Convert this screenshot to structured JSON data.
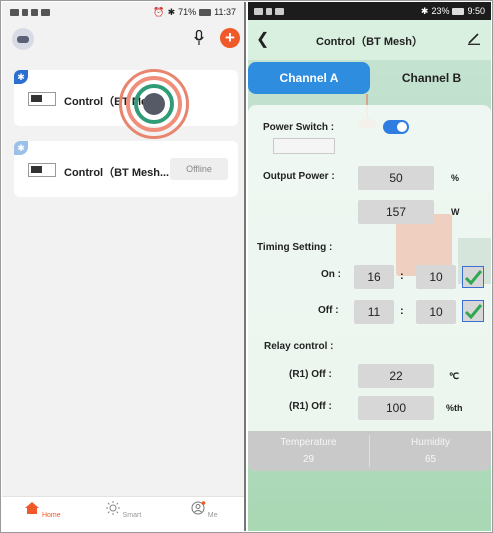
{
  "left_phone": {
    "status": {
      "battery": "71%",
      "time": "11:37"
    },
    "devices": [
      {
        "name": "Control（BT Mesh）",
        "status": ""
      },
      {
        "name": "Control（BT Mesh...",
        "status": "Offline"
      }
    ],
    "nav": [
      {
        "label": "Home",
        "icon": "home-icon"
      },
      {
        "label": "Smart",
        "icon": "sun-icon"
      },
      {
        "label": "Me",
        "icon": "profile-icon"
      }
    ],
    "colors": {
      "accent": "#f05a2a",
      "bluetooth": "#2c6fd1"
    }
  },
  "right_phone": {
    "status": {
      "battery": "23%",
      "time": "9:50"
    },
    "title": "Control（BT Mesh）",
    "tabs": {
      "a": "Channel A",
      "b": "Channel B"
    },
    "power_switch": {
      "label": "Power Switch :",
      "on": true
    },
    "output_power": {
      "label": "Output Power :",
      "percent": "50",
      "percent_unit": "%",
      "watts": "157",
      "watts_unit": "W"
    },
    "timing": {
      "label": "Timing Setting :",
      "on_label": "On :",
      "on_hour": "16",
      "on_minute": "10",
      "off_label": "Off :",
      "off_hour": "11",
      "off_minute": "10",
      "separator": ":"
    },
    "relay": {
      "label": "Relay control :",
      "row1_label": "(R1)  Off :",
      "row1_value": "22",
      "row1_unit": "℃",
      "row2_label": "(R1)  Off :",
      "row2_value": "100",
      "row2_unit": "%th"
    },
    "sensors": {
      "temperature_label": "Temperature",
      "temperature": "29",
      "humidity_label": "Humidity",
      "humidity": "65"
    },
    "colors": {
      "tab_active": "#2f8ddf",
      "toggle": "#2f7de0",
      "check": "#2fa84f"
    }
  }
}
